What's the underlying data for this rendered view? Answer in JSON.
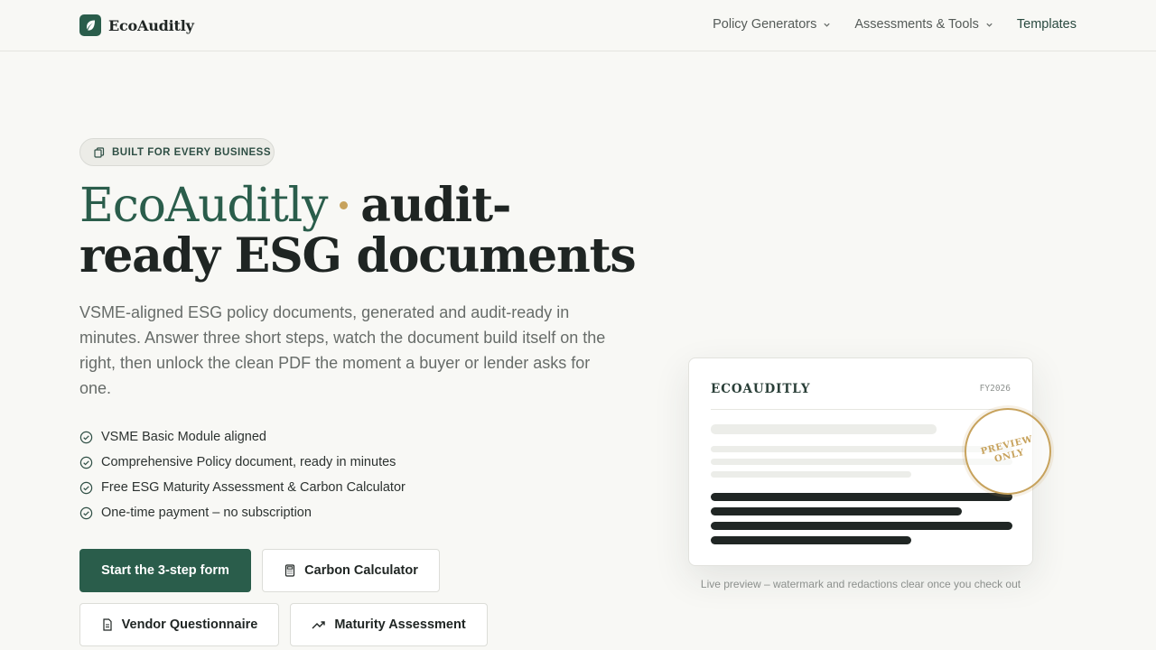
{
  "brand": {
    "name": "EcoAuditly"
  },
  "nav": {
    "items": [
      {
        "label": "Policy Generators",
        "dropdown": true
      },
      {
        "label": "Assessments & Tools",
        "dropdown": true
      },
      {
        "label": "Templates",
        "dropdown": false
      }
    ]
  },
  "hero": {
    "badge": "BUILT FOR EVERY BUSINESS",
    "headline_brand": "EcoAuditly",
    "headline_rest": "audit-ready ESG documents",
    "lead": "VSME-aligned ESG policy documents, generated and audit-ready in minutes. Answer three short steps, watch the document build itself on the right, then unlock the clean PDF the moment a buyer or lender asks for one.",
    "checklist": [
      "VSME Basic Module aligned",
      "Comprehensive Policy document, ready in minutes",
      "Free ESG Maturity Assessment & Carbon Calculator",
      "One-time payment – no subscription"
    ],
    "buttons": {
      "primary": "Start the 3-step form",
      "carbon": "Carbon Calculator",
      "vendor": "Vendor Questionnaire",
      "maturity": "Maturity Assessment"
    }
  },
  "preview": {
    "title": "ECOAUDITLY",
    "fiscal_year": "FY2026",
    "stamp_line1": "PREVIEW",
    "stamp_line2": "ONLY",
    "caption": "Live preview – watermark and redactions clear once you check out"
  },
  "colors": {
    "accent": "#2a5d4b",
    "gold": "#c7a25c",
    "background": "#f8f8f5"
  },
  "icons": {
    "brand": "leaf-icon",
    "badge": "documents-icon",
    "check": "check-circle-icon",
    "carbon": "calculator-icon",
    "vendor": "document-icon",
    "maturity": "trend-up-icon"
  }
}
